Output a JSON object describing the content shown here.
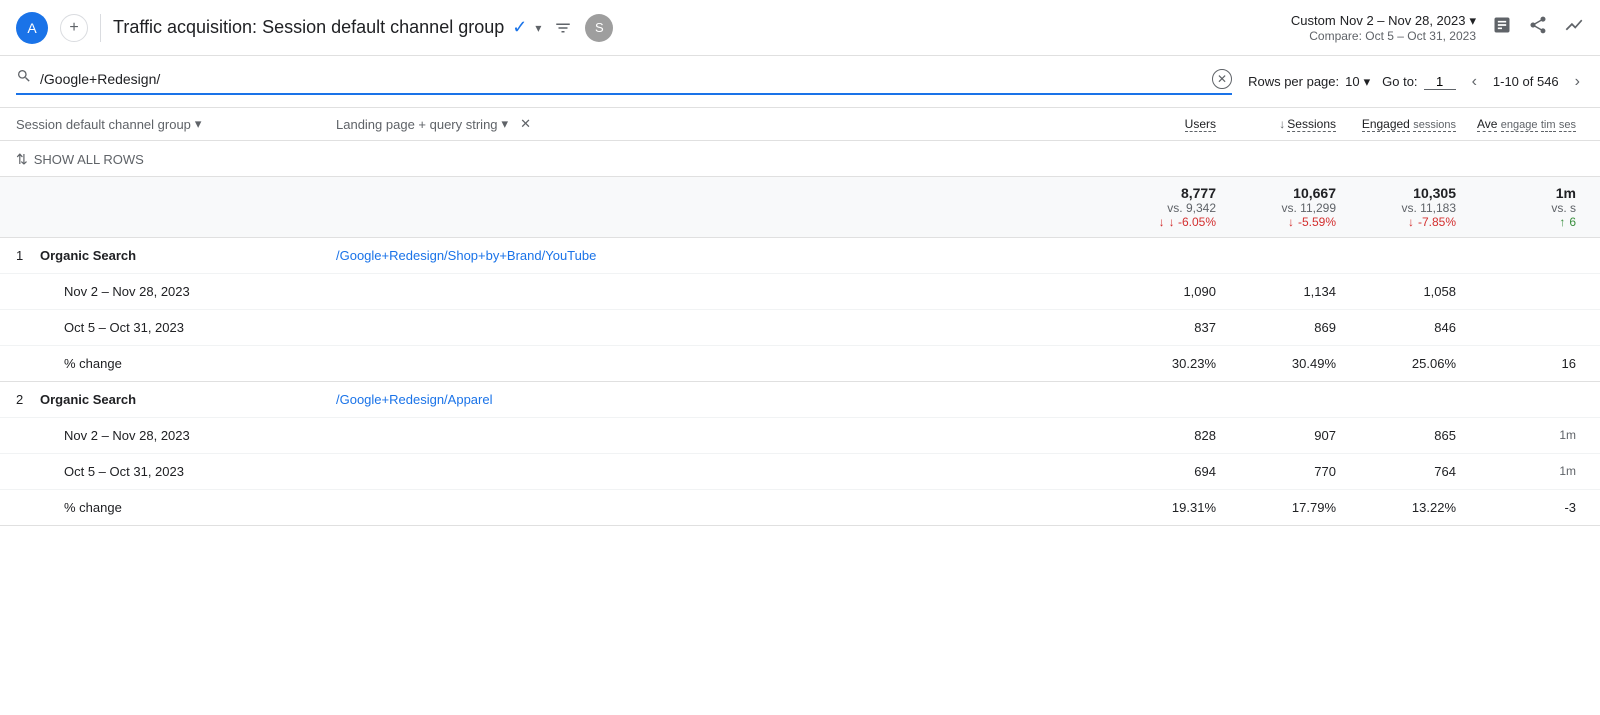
{
  "topbar": {
    "avatar_label": "A",
    "add_button_label": "+",
    "title": "Traffic acquisition: Session default channel group",
    "check_icon": "✓",
    "date_label": "Custom",
    "date_primary": "Nov 2 – Nov 28, 2023",
    "date_compare": "Compare: Oct 5 – Oct 31, 2023",
    "s_badge": "S"
  },
  "search": {
    "placeholder": "/Google+Redesign/",
    "current_value": "/Google+Redesign/"
  },
  "pagination": {
    "rows_per_page_label": "Rows per page:",
    "rows_per_page_value": "10",
    "goto_label": "Go to:",
    "goto_value": "1",
    "page_info": "1-10 of 546"
  },
  "table": {
    "col1_label": "Session default channel group",
    "col2_label": "Landing page + query string",
    "col3_label": "Users",
    "col4_label": "Sessions",
    "col5_label": "Engaged sessions",
    "col6_label": "Ave engaged tim ses",
    "show_all_rows": "SHOW ALL ROWS",
    "totals": {
      "users_value": "8,777",
      "users_compare": "vs. 9,342",
      "users_change": "↓ -6.05%",
      "sessions_value": "10,667",
      "sessions_compare": "vs. 11,299",
      "sessions_change": "↓ -5.59%",
      "engaged_value": "10,305",
      "engaged_compare": "vs. 11,183",
      "engaged_change": "↓ -7.85%",
      "avg_value": "1m",
      "avg_compare": "vs. s",
      "avg_change": "↑ 6"
    },
    "rows": [
      {
        "num": "1",
        "dim1": "Organic Search",
        "dim2": "/Google+Redesign/Shop+by+Brand/YouTube",
        "subrows": [
          {
            "label": "Nov 2 – Nov 28, 2023",
            "users": "1,090",
            "sessions": "1,134",
            "engaged": "1,058",
            "avg": ""
          },
          {
            "label": "Oct 5 – Oct 31, 2023",
            "users": "837",
            "sessions": "869",
            "engaged": "846",
            "avg": ""
          },
          {
            "label": "% change",
            "users": "30.23%",
            "sessions": "30.49%",
            "engaged": "25.06%",
            "avg": "16"
          }
        ]
      },
      {
        "num": "2",
        "dim1": "Organic Search",
        "dim2": "/Google+Redesign/Apparel",
        "subrows": [
          {
            "label": "Nov 2 – Nov 28, 2023",
            "users": "828",
            "sessions": "907",
            "engaged": "865",
            "avg": "1m"
          },
          {
            "label": "Oct 5 – Oct 31, 2023",
            "users": "694",
            "sessions": "770",
            "engaged": "764",
            "avg": "1m"
          },
          {
            "label": "% change",
            "users": "19.31%",
            "sessions": "17.79%",
            "engaged": "13.22%",
            "avg": "-3"
          }
        ]
      }
    ]
  }
}
